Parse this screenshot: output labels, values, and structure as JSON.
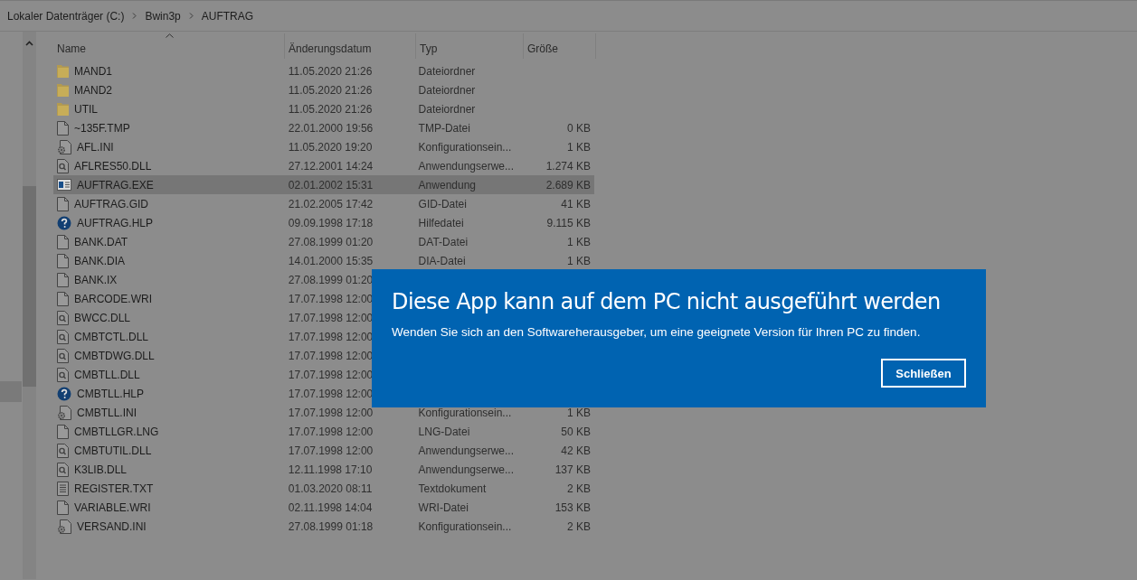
{
  "breadcrumb": [
    "Lokaler Datenträger (C:)",
    "Bwin3p",
    "AUFTRAG"
  ],
  "columns": [
    {
      "label": "Name",
      "sorted": true
    },
    {
      "label": "Änderungsdatum",
      "sorted": false
    },
    {
      "label": "Typ",
      "sorted": false
    },
    {
      "label": "Größe",
      "sorted": false
    }
  ],
  "rows": [
    {
      "kind": "folder",
      "name": "MAND1",
      "date": "11.05.2020 21:26",
      "type": "Dateiordner",
      "selected": false
    },
    {
      "kind": "folder",
      "name": "MAND2",
      "date": "11.05.2020 21:26",
      "type": "Dateiordner",
      "selected": false
    },
    {
      "kind": "folder",
      "name": "UTIL",
      "date": "11.05.2020 21:26",
      "type": "Dateiordner",
      "selected": false
    },
    {
      "kind": "file",
      "name": "~135F.TMP",
      "date": "22.01.2000 19:56",
      "type": "TMP-Datei",
      "size": "0 KB",
      "selected": false
    },
    {
      "kind": "ini",
      "name": "AFL.INI",
      "date": "11.05.2020 19:20",
      "type": "Konfigurationsein...",
      "size": "1 KB",
      "selected": false
    },
    {
      "kind": "dll",
      "name": "AFLRES50.DLL",
      "date": "27.12.2001 14:24",
      "type": "Anwendungserwe...",
      "size": "1.274 KB",
      "selected": false
    },
    {
      "kind": "exe",
      "name": "AUFTRAG.EXE",
      "date": "02.01.2002 15:31",
      "type": "Anwendung",
      "size": "2.689 KB",
      "selected": true
    },
    {
      "kind": "file",
      "name": "AUFTRAG.GID",
      "date": "21.02.2005 17:42",
      "type": "GID-Datei",
      "size": "41 KB",
      "selected": false
    },
    {
      "kind": "help",
      "name": "AUFTRAG.HLP",
      "date": "09.09.1998 17:18",
      "type": "Hilfedatei",
      "size": "9.115 KB",
      "selected": false
    },
    {
      "kind": "file",
      "name": "BANK.DAT",
      "date": "27.08.1999 01:20",
      "type": "DAT-Datei",
      "size": "1 KB",
      "selected": false
    },
    {
      "kind": "file",
      "name": "BANK.DIA",
      "date": "14.01.2000 15:35",
      "type": "DIA-Datei",
      "size": "1 KB",
      "selected": false
    },
    {
      "kind": "file",
      "name": "BANK.IX",
      "date": "27.08.1999 01:20",
      "selected": false
    },
    {
      "kind": "file",
      "name": "BARCODE.WRI",
      "date": "17.07.1998 12:00",
      "selected": false
    },
    {
      "kind": "dll",
      "name": "BWCC.DLL",
      "date": "17.07.1998 12:00",
      "selected": false
    },
    {
      "kind": "dll",
      "name": "CMBTCTL.DLL",
      "date": "17.07.1998 12:00",
      "selected": false
    },
    {
      "kind": "dll",
      "name": "CMBTDWG.DLL",
      "date": "17.07.1998 12:00",
      "selected": false
    },
    {
      "kind": "dll",
      "name": "CMBTLL.DLL",
      "date": "17.07.1998 12:00",
      "selected": false
    },
    {
      "kind": "help",
      "name": "CMBTLL.HLP",
      "date": "17.07.1998 12:00",
      "selected": false
    },
    {
      "kind": "ini",
      "name": "CMBTLL.INI",
      "date": "17.07.1998 12:00",
      "type": "Konfigurationsein...",
      "size": "1 KB",
      "selected": false
    },
    {
      "kind": "file",
      "name": "CMBTLLGR.LNG",
      "date": "17.07.1998 12:00",
      "type": "LNG-Datei",
      "size": "50 KB",
      "selected": false
    },
    {
      "kind": "dll",
      "name": "CMBTUTIL.DLL",
      "date": "17.07.1998 12:00",
      "type": "Anwendungserwe...",
      "size": "42 KB",
      "selected": false
    },
    {
      "kind": "dll",
      "name": "K3LIB.DLL",
      "date": "12.11.1998 17:10",
      "type": "Anwendungserwe...",
      "size": "137 KB",
      "selected": false
    },
    {
      "kind": "text",
      "name": "REGISTER.TXT",
      "date": "01.03.2020 08:11",
      "type": "Textdokument",
      "size": "2 KB",
      "selected": false
    },
    {
      "kind": "file",
      "name": "VARIABLE.WRI",
      "date": "02.11.1998 14:04",
      "type": "WRI-Datei",
      "size": "153 KB",
      "selected": false
    },
    {
      "kind": "ini",
      "name": "VERSAND.INI",
      "date": "27.08.1999 01:18",
      "type": "Konfigurationsein...",
      "size": "2 KB",
      "selected": false
    }
  ],
  "dialog": {
    "title": "Diese App kann auf dem PC nicht ausgeführt werden",
    "message": "Wenden Sie sich an den Softwareherausgeber, um eine geeignete Version für Ihren PC zu finden.",
    "button": "Schließen"
  }
}
